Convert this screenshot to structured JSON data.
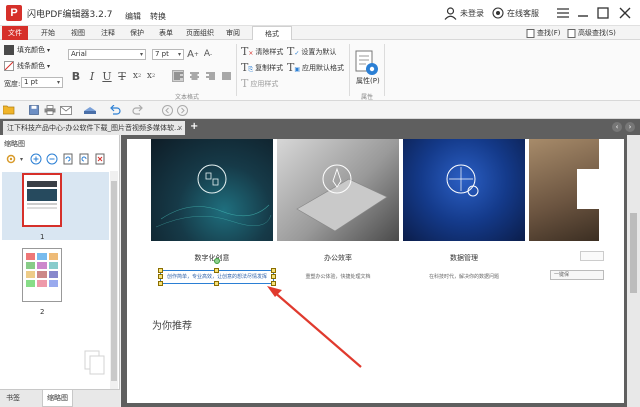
{
  "app": {
    "title": "闪电PDF编辑器3.2.7",
    "mode_edit": "编辑",
    "mode_convert": "转换",
    "login": "未登录",
    "service": "在线客服"
  },
  "menu": {
    "tabs": [
      "文件",
      "开始",
      "视图",
      "注释",
      "保护",
      "表单",
      "页面组织",
      "审阅",
      "格式"
    ],
    "find": "查找(F)",
    "advanced_find": "高级查找(S)"
  },
  "ribbon": {
    "fill_color": "填充颜色",
    "line_color": "线条颜色",
    "width_label": "宽度:",
    "width_value": "1 pt",
    "font_value": "Arial",
    "size_value": "7 pt",
    "clear_style": "清除样式",
    "set_default": "设置为默认",
    "copy_style": "复制样式",
    "apply_default": "应用默认格式",
    "apply_style": "应用样式",
    "properties": "属性(P)",
    "group_text": "文本格式",
    "group_props": "属性",
    "colors": {
      "fill": "#4a4a4a",
      "brand": "#d6302a"
    }
  },
  "tab": {
    "title": "江下科技产品中心-办公软件下载_图片音视频多媒体软..."
  },
  "sidebar": {
    "title": "缩略图",
    "pages": [
      "1",
      "2"
    ],
    "bottom_tabs": [
      "书签",
      "缩略图"
    ]
  },
  "page": {
    "cards": [
      {
        "title": "数字化创意",
        "sub": "创作简单，专业高效，让创意的想法尽情发挥"
      },
      {
        "title": "办公效率",
        "sub": "重塑办公体验，快捷处理文档"
      },
      {
        "title": "数据管理",
        "sub": "在科技时代，解决你的数据问题"
      }
    ],
    "side_input": "一键保",
    "recommend": "为你推荐"
  }
}
